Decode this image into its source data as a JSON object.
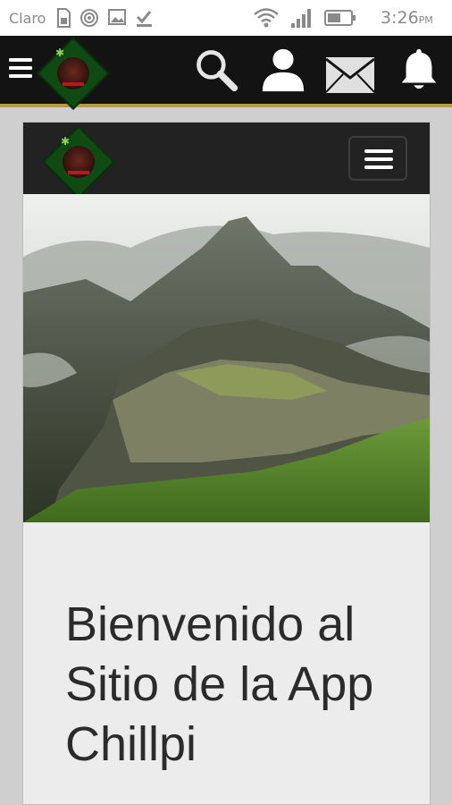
{
  "status_bar": {
    "carrier": "Claro",
    "time": "3:26",
    "time_suffix": "PM"
  },
  "app_bar": {
    "icons": [
      "menu-icon",
      "search-icon",
      "user-icon",
      "mail-icon",
      "bell-icon"
    ]
  },
  "site": {
    "welcome_title": "Bienvenido al Sitio de la App Chillpi",
    "hero_image": "mountain-ruins-landscape"
  },
  "colors": {
    "toolbar": "#131313",
    "accent_border": "#b89a44",
    "site_nav": "#222222",
    "site_body": "#ececec",
    "title_text": "#2b2b2b"
  }
}
